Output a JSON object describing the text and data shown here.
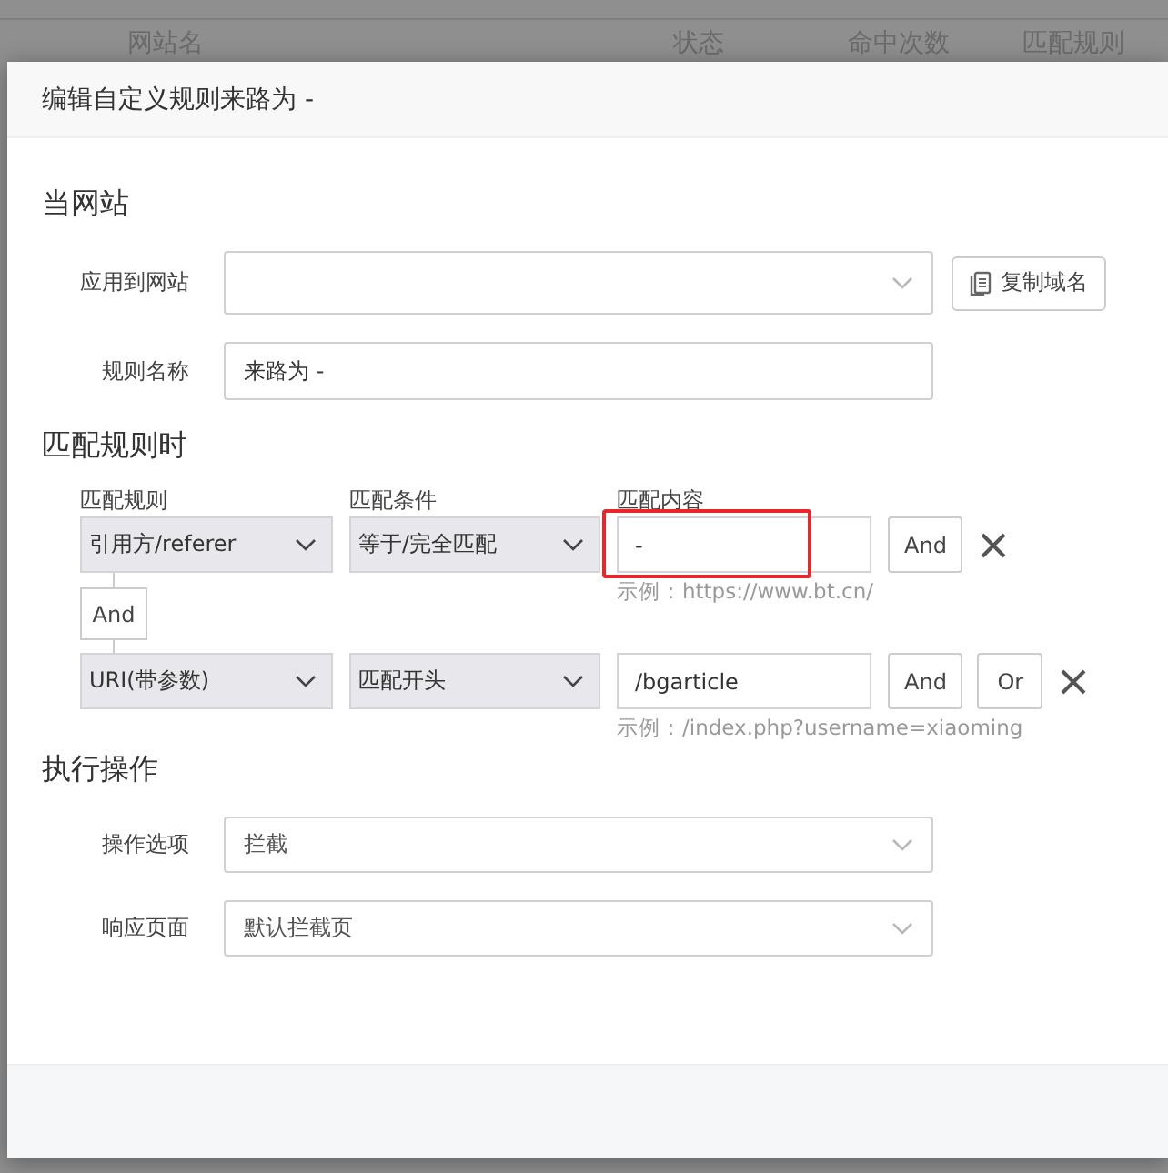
{
  "background_table": {
    "columns": [
      "网站名",
      "状态",
      "命中次数",
      "匹配规则"
    ]
  },
  "dialog": {
    "title": "编辑自定义规则来路为 -",
    "site_section": {
      "title": "当网站",
      "fields": [
        {
          "kind": "select",
          "label": "应用到网站",
          "button": "复制域名"
        },
        {
          "kind": "input",
          "label": "规则名称",
          "value": "来路为 -"
        }
      ]
    },
    "match_section": {
      "title": "匹配规则时",
      "columns": [
        "匹配规则",
        "匹配条件",
        "匹配内容"
      ],
      "rules": [
        {
          "rule": "引用方/referer",
          "condition": "等于/完全匹配",
          "content": "-",
          "hint": "示例：https://www.bt.cn/",
          "highlighted": true,
          "buttons": [
            "And"
          ]
        },
        {
          "joiner": "And",
          "rule": "URI(带参数)",
          "condition": "匹配开头",
          "content": "/bgarticle",
          "hint": "示例：/index.php?username=xiaoming",
          "highlighted": false,
          "buttons": [
            "And",
            "Or"
          ]
        }
      ]
    },
    "action_section": {
      "title": "执行操作",
      "fields": [
        {
          "kind": "select",
          "label": "操作选项",
          "value": "拦截"
        },
        {
          "kind": "select",
          "label": "响应页面",
          "value": "默认拦截页"
        }
      ]
    }
  }
}
